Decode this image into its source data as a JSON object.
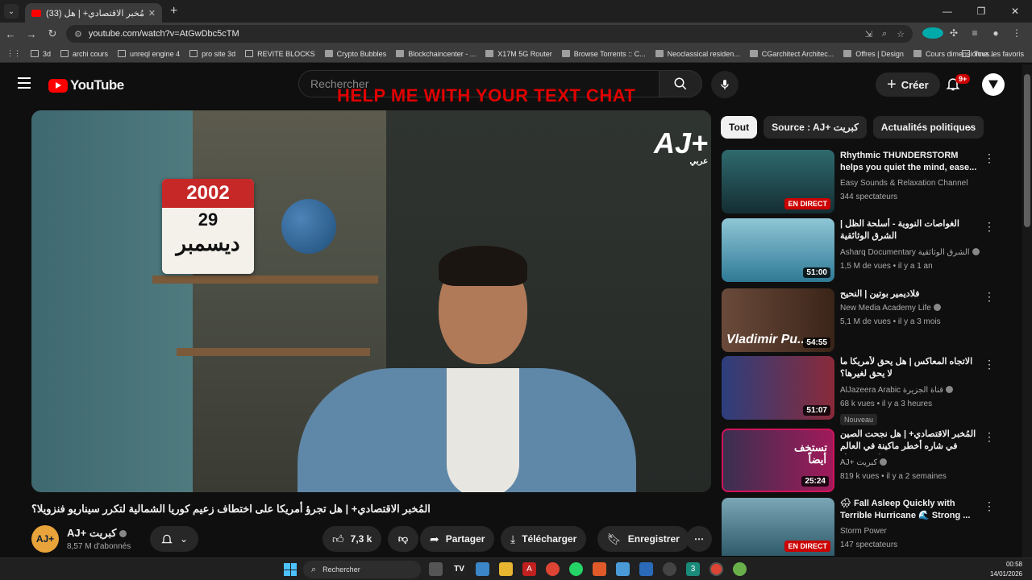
{
  "browser": {
    "tab_title": "(33) المُخبر الاقتصادي+ | هل ...",
    "url": "youtube.com/watch?v=AtGwDbc5cTM",
    "bookmarks": [
      {
        "label": "3d",
        "icon": "folder-icon"
      },
      {
        "label": "archi cours",
        "icon": "folder-icon"
      },
      {
        "label": "unreql engine 4",
        "icon": "folder-icon"
      },
      {
        "label": "pro site 3d",
        "icon": "folder-icon"
      },
      {
        "label": "REVITE BLOCKS",
        "icon": "folder-icon"
      },
      {
        "label": "Crypto Bubbles",
        "icon": "site-icon"
      },
      {
        "label": "Blockchaincenter - ...",
        "icon": "site-icon"
      },
      {
        "label": "X17M 5G Router",
        "icon": "site-icon"
      },
      {
        "label": "Browse Torrents :: C...",
        "icon": "site-icon"
      },
      {
        "label": "Neoclassical residen...",
        "icon": "site-icon"
      },
      {
        "label": "CGarchitect Architec...",
        "icon": "site-icon"
      },
      {
        "label": "Offres | Design",
        "icon": "site-icon"
      },
      {
        "label": "Cours dimensionne...",
        "icon": "site-icon"
      }
    ],
    "bookmarks_all": "Tous les favoris"
  },
  "youtube": {
    "logo_text": "YouTube",
    "search_placeholder": "Rechercher",
    "overlay_caption": "HELP ME WITH YOUR TEXT CHAT",
    "create_label": "Créer",
    "notif_count": "9+"
  },
  "video": {
    "calendar_year": "2002",
    "calendar_day": "29",
    "calendar_month": "ديسمبر",
    "watermark": "AJ+",
    "watermark_sub": "عربي",
    "title": "المُخبر الاقتصادي+ | هل تجرؤ أمريكا على اختطاف زعيم كوريا الشمالية لتكرر سيناريو فنزويلا؟",
    "channel_name": "AJ+ كبريت",
    "channel_subs": "8,57 M d'abonnés",
    "likes": "7,3 k",
    "share_label": "Partager",
    "download_label": "Télécharger",
    "save_label": "Enregistrer"
  },
  "chips": [
    "Tout",
    "Source : AJ+ كبريت",
    "Actualités politiques"
  ],
  "recommendations": [
    {
      "title": "Rhythmic THUNDERSTORM helps you quiet the mind, ease...",
      "channel": "Easy Sounds & Relaxation Channel",
      "meta": "344 spectateurs",
      "badge": "EN DIRECT",
      "badge_type": "live",
      "verified": false,
      "thumb_color": "#1f4a52"
    },
    {
      "title": "الغواصات النووية - أسلحة الظل | الشرق الوثائقية",
      "channel": "Asharq Documentary الشرق الوثائقية",
      "meta": "1,5 M de vues • il y a 1 an",
      "badge": "51:00",
      "badge_type": "duration",
      "verified": true,
      "thumb_color": "#3f8fa8"
    },
    {
      "title": "فلاديمير بوتين | النحيح",
      "channel": "New Media Academy Life",
      "meta": "5,1 M de vues • il y a 3 mois",
      "badge": "54:55",
      "badge_type": "duration",
      "verified": true,
      "thumb_color": "#5a3a2a",
      "thumb_text": "Vladimir Pu..."
    },
    {
      "title": "الاتجاه المعاكس | هل يحق لأمريكا ما لا يحق لغيرها؟",
      "channel": "AlJazeera Arabic قناة الجزيرة",
      "meta": "68 k vues • il y a 3 heures",
      "badge": "51:07",
      "badge_type": "duration",
      "verified": true,
      "thumb_color": "#2a3f7a",
      "new_label": "Nouveau"
    },
    {
      "title": "المُخبر الاقتصادي+ | هل نجحت الصين في شاره أخطر ماكينة في العالم وكسر حصار ...",
      "channel": "AJ+ كبريت",
      "meta": "819 k vues • il y a 2 semaines",
      "badge": "25:24",
      "badge_type": "duration",
      "verified": true,
      "thumb_color": "#8a1a4a",
      "thumb_text": "تستخف أيضاً"
    },
    {
      "title": "🌧 Fall Asleep Quickly with Terrible Hurricane 🌊 Strong ...",
      "channel": "Storm Power",
      "meta": "147 spectateurs",
      "badge": "EN DIRECT",
      "badge_type": "live",
      "verified": false,
      "thumb_color": "#4a7a8a"
    }
  ],
  "taskbar": {
    "search_label": "Rechercher",
    "time": "00:58",
    "date": "14/01/2026"
  }
}
